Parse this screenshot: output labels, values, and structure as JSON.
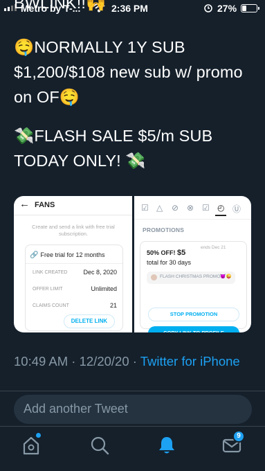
{
  "status_bar": {
    "carrier": "Metro by T-...",
    "time": "2:36 PM",
    "battery_percent": "27%",
    "battery_level": 0.27,
    "icons": [
      "signal-icon",
      "wifi-icon",
      "alarm-icon",
      "battery-icon"
    ]
  },
  "tweet": {
    "cut_off_line": "BWLINK!!🙌",
    "paragraph1": "🤤NORMALLY 1Y SUB $1,200/$108 new sub w/ promo on OF🤤",
    "paragraph2": "💸FLASH SALE $5/m SUB TODAY ONLY! 💸",
    "timestamp": "10:49 AM · 12/20/20 · ",
    "source": "Twitter for iPhone"
  },
  "media_left": {
    "title": "FANS",
    "subtitle": "Create and send a link with free trial subscription.",
    "trial_label": "Free trial for 12 months",
    "rows": [
      {
        "key": "LINK CREATED",
        "value": "Dec 8, 2020"
      },
      {
        "key": "OFFER LIMIT",
        "value": "Unlimited"
      },
      {
        "key": "CLAIMS COUNT",
        "value": "21"
      }
    ],
    "delete_label": "DELETE LINK"
  },
  "media_right": {
    "section_title": "PROMOTIONS",
    "offer_line1": "50% OFF!",
    "offer_price": "$5",
    "offer_line2": "total for 30 days",
    "ends_label": "ends Dec 21",
    "flash_text": "FLASH CHRISTMAS PROMO😈😜",
    "stop_label": "STOP PROMOTION",
    "copy_label": "COPY LINK TO PROFILE"
  },
  "reply": {
    "placeholder": "Add another Tweet"
  },
  "tab_bar": {
    "notifications_badge": "9",
    "accent": "#1da1f2"
  },
  "colors": {
    "background": "#15202b",
    "muted_text": "#8899a6",
    "link": "#1da1f2",
    "of_blue": "#00aff0"
  }
}
